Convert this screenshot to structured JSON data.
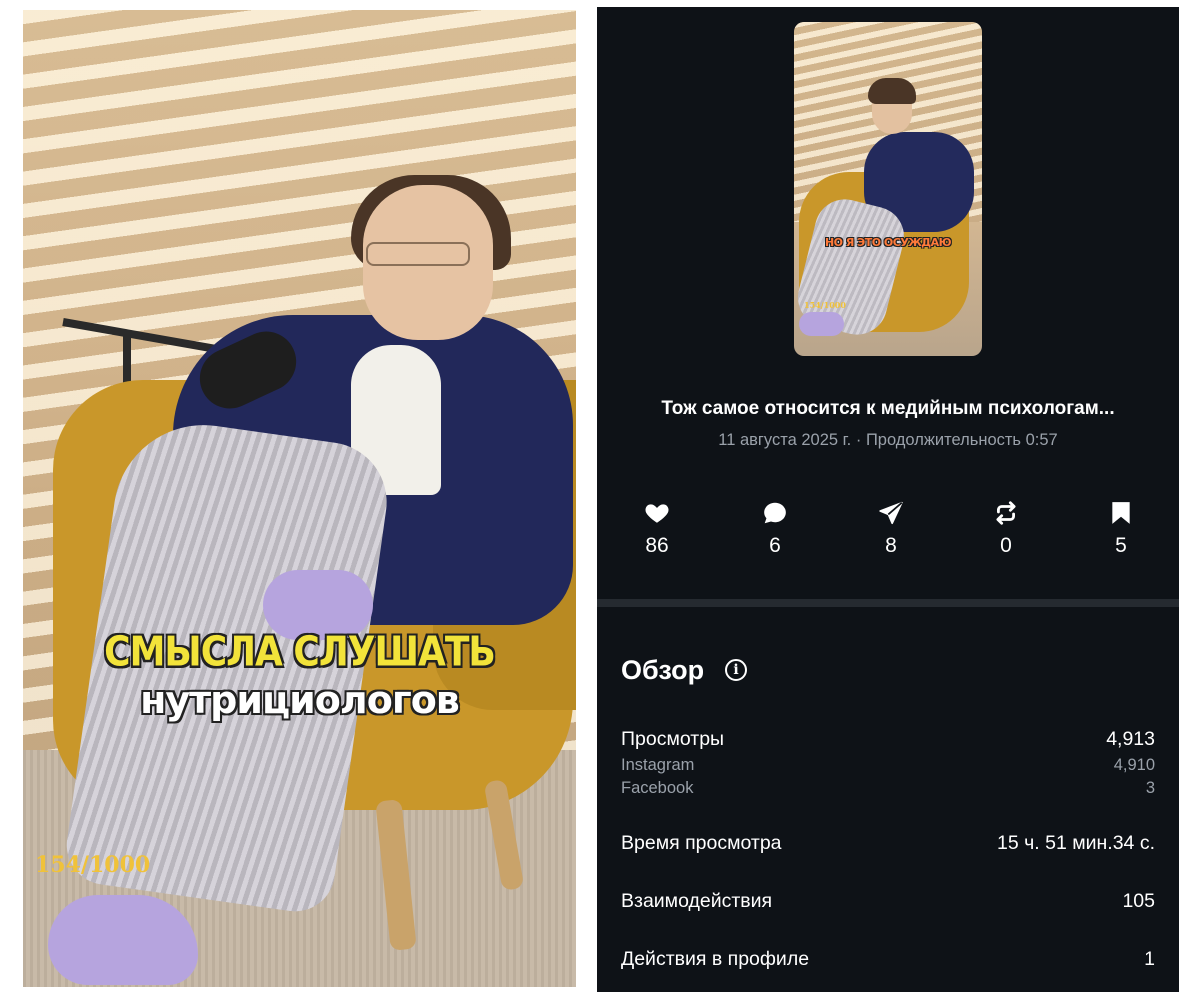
{
  "left_video": {
    "caption_line1": "СМЫСЛА СЛУШАТЬ",
    "caption_line2": "нутрициологов",
    "counter": "154/1000"
  },
  "insights": {
    "thumbnail": {
      "caption": "НО Я ЭТО ОСУЖДАЮ",
      "counter": "154/1000"
    },
    "title": "Тож самое относится к медийным психологам...",
    "date": "11 августа 2025 г.",
    "separator": "·",
    "duration": "Продолжительность 0:57",
    "stats": [
      {
        "icon": "heart-icon",
        "value": "86"
      },
      {
        "icon": "comment-icon",
        "value": "6"
      },
      {
        "icon": "share-icon",
        "value": "8"
      },
      {
        "icon": "repost-icon",
        "value": "0"
      },
      {
        "icon": "bookmark-icon",
        "value": "5"
      }
    ],
    "overview": {
      "title": "Обзор",
      "info_icon": "info-icon",
      "views_label": "Просмотры",
      "views_value": "4,913",
      "instagram_label": "Instagram",
      "instagram_value": "4,910",
      "facebook_label": "Facebook",
      "facebook_value": "3",
      "watch_time_label": "Время просмотра",
      "watch_time_value": "15 ч. 51 мин.34 с.",
      "interactions_label": "Взаимодействия",
      "interactions_value": "105",
      "profile_actions_label": "Действия в профиле",
      "profile_actions_value": "1"
    }
  },
  "colors": {
    "panel_bg": "#0e1217",
    "secondary_text": "#9aa1aa",
    "caption_yellow": "#f2e33a",
    "caption_orange": "#ff7a3a"
  }
}
